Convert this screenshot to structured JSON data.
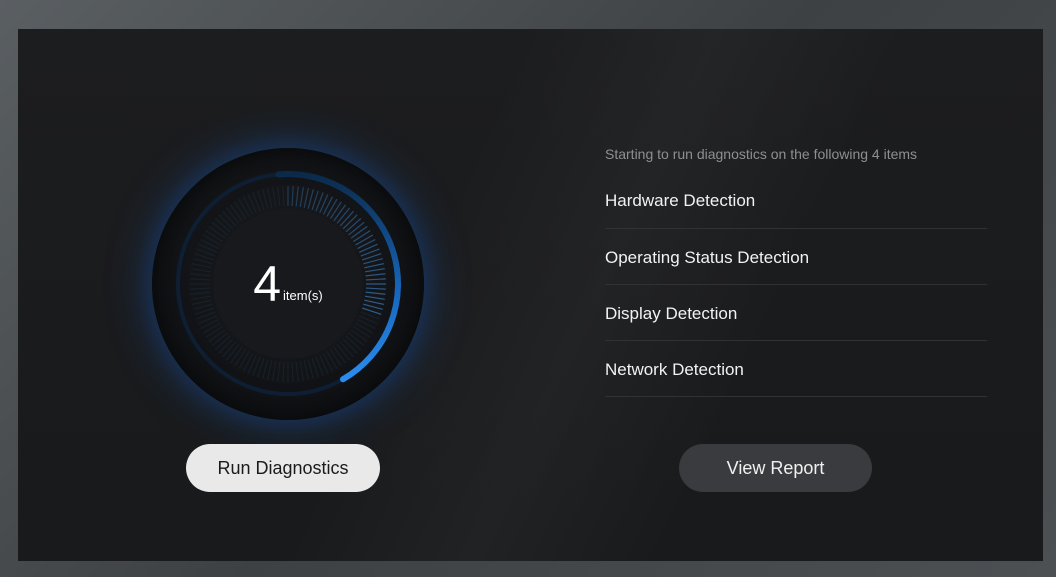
{
  "dial": {
    "count": "4",
    "unit": "item(s)",
    "progress": 0.3,
    "accent_color": "#1a7fe0"
  },
  "diagnostics": {
    "intro": "Starting to run diagnostics on the following 4 items",
    "items": [
      {
        "label": "Hardware Detection"
      },
      {
        "label": "Operating Status Detection"
      },
      {
        "label": "Display Detection"
      },
      {
        "label": "Network Detection"
      }
    ]
  },
  "actions": {
    "run_label": "Run Diagnostics",
    "report_label": "View Report"
  },
  "colors": {
    "background": "#1b1c1e",
    "run_button": "#e9e9e9",
    "report_button": "#3a3b3e",
    "accent": "#1a7fe0"
  }
}
